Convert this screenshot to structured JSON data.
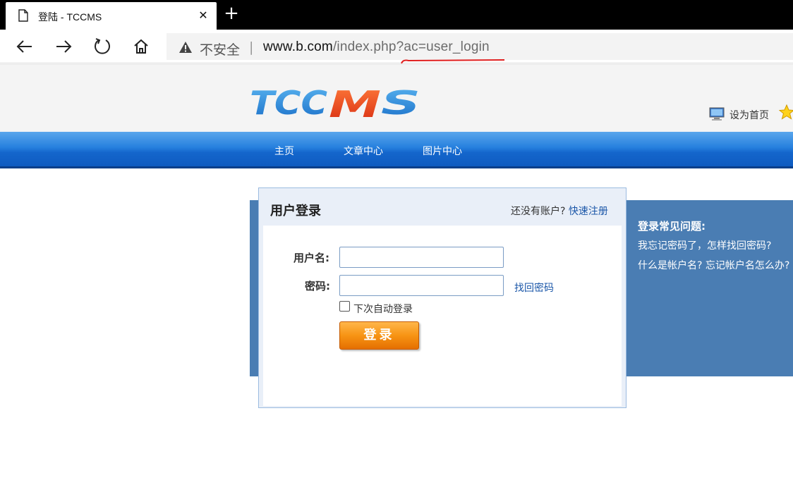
{
  "browser": {
    "tab_title": "登陆 - TCCMS",
    "close_glyph": "✕",
    "newtab_glyph": "+",
    "security_label": "不安全",
    "separator": "|",
    "url_host": "www.b.com",
    "url_path": "/index.php?ac=user_login",
    "annotation_color": "#e02020"
  },
  "site": {
    "logo_text": "TCCMS",
    "set_home_label": "设为首页",
    "nav": [
      {
        "label": "主页"
      },
      {
        "label": "文章中心"
      },
      {
        "label": "图片中心"
      }
    ]
  },
  "login": {
    "title": "用户登录",
    "no_account_text": "还没有账户?",
    "register_link": "快速注册",
    "username_label": "用户名:",
    "password_label": "密码:",
    "username_value": "",
    "password_value": "",
    "forgot_link": "找回密码",
    "remember_label": "下次自动登录",
    "remember_checked": false,
    "submit_label": "登录"
  },
  "faq": {
    "title": "登录常见问题:",
    "items": [
      {
        "text": "我忘记密码了，怎样找回密码?"
      },
      {
        "text": "什么是帐户名? 忘记帐户名怎么办?"
      }
    ]
  },
  "colors": {
    "nav_blue": "#2680de",
    "panel_blue": "#4a7db3",
    "button_orange": "#f79414",
    "link_blue": "#1a56a8"
  }
}
